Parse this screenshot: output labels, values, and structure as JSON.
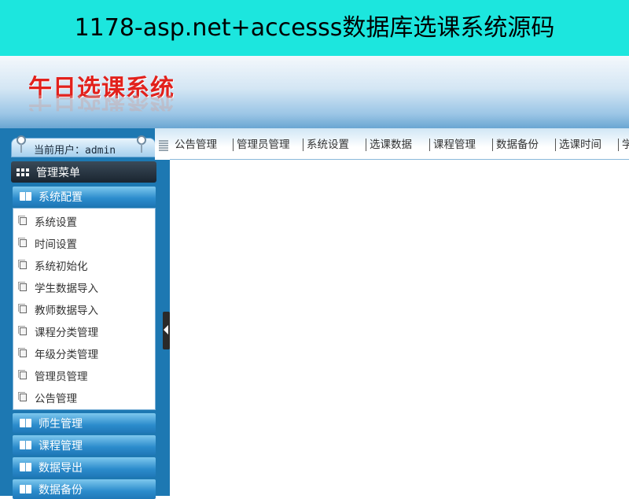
{
  "banner": {
    "title": "1178-asp.net+accesss数据库选课系统源码"
  },
  "app": {
    "logo_text": "午日选课系统"
  },
  "user": {
    "label": "当前用户：admin"
  },
  "menu": {
    "title": "管理菜单",
    "sections": [
      {
        "label": "系统配置",
        "expanded": true,
        "items": [
          "系统设置",
          "时间设置",
          "系统初始化",
          "学生数据导入",
          "教师数据导入",
          "课程分类管理",
          "年级分类管理",
          "管理员管理",
          "公告管理"
        ]
      },
      {
        "label": "师生管理",
        "expanded": false
      },
      {
        "label": "课程管理",
        "expanded": false
      },
      {
        "label": "数据导出",
        "expanded": false
      },
      {
        "label": "数据备份",
        "expanded": false
      }
    ]
  },
  "topnav": {
    "items": [
      "公告管理",
      "管理员管理",
      "系统设置",
      "选课数据",
      "课程管理",
      "数据备份",
      "选课时间",
      "学"
    ]
  },
  "colors": {
    "banner": "#1ce6de",
    "sidebar": "#1d78b2",
    "logo": "#e2211c"
  },
  "icons": {
    "menu_title": "grid-icon",
    "section": "book-icon",
    "item": "document-icon",
    "collapse": "chevron-left-icon"
  }
}
